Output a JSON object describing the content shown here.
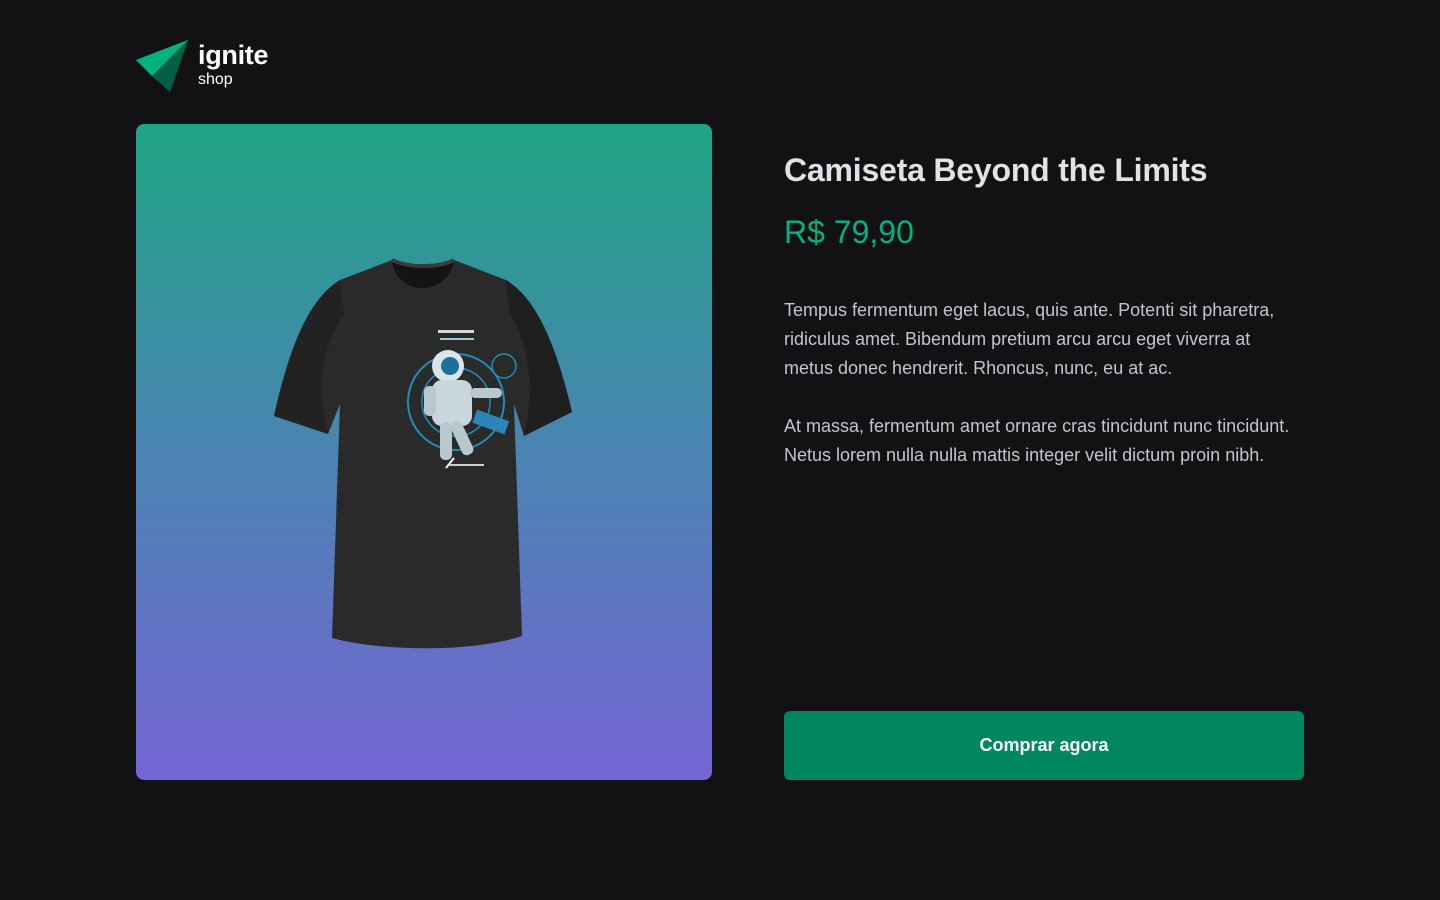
{
  "header": {
    "logo_name": "ignite",
    "logo_sub": "shop",
    "logo_icon": "triangle-logo-icon",
    "brand_color": "#00875f"
  },
  "product": {
    "image_icon": "tshirt-image",
    "title": "Camiseta Beyond the Limits",
    "price": "R$ 79,90",
    "description": [
      "Tempus fermentum eget lacus, quis ante. Potenti sit pharetra, ridiculus amet. Bibendum pretium arcu arcu eget viverra at metus donec hendrerit. Rhoncus, nunc, eu at ac.",
      "At massa, fermentum amet ornare cras tincidunt nunc tincidunt. Netus lorem nulla nulla mattis integer velit dictum proin nibh."
    ],
    "buy_label": "Comprar agora"
  },
  "colors": {
    "background": "#121214",
    "title": "#e1e1e6",
    "price": "#00b37e",
    "text": "#c4c4cc",
    "button": "#00875f",
    "gradient_top": "#1ea483",
    "gradient_bottom": "#7465d4"
  }
}
